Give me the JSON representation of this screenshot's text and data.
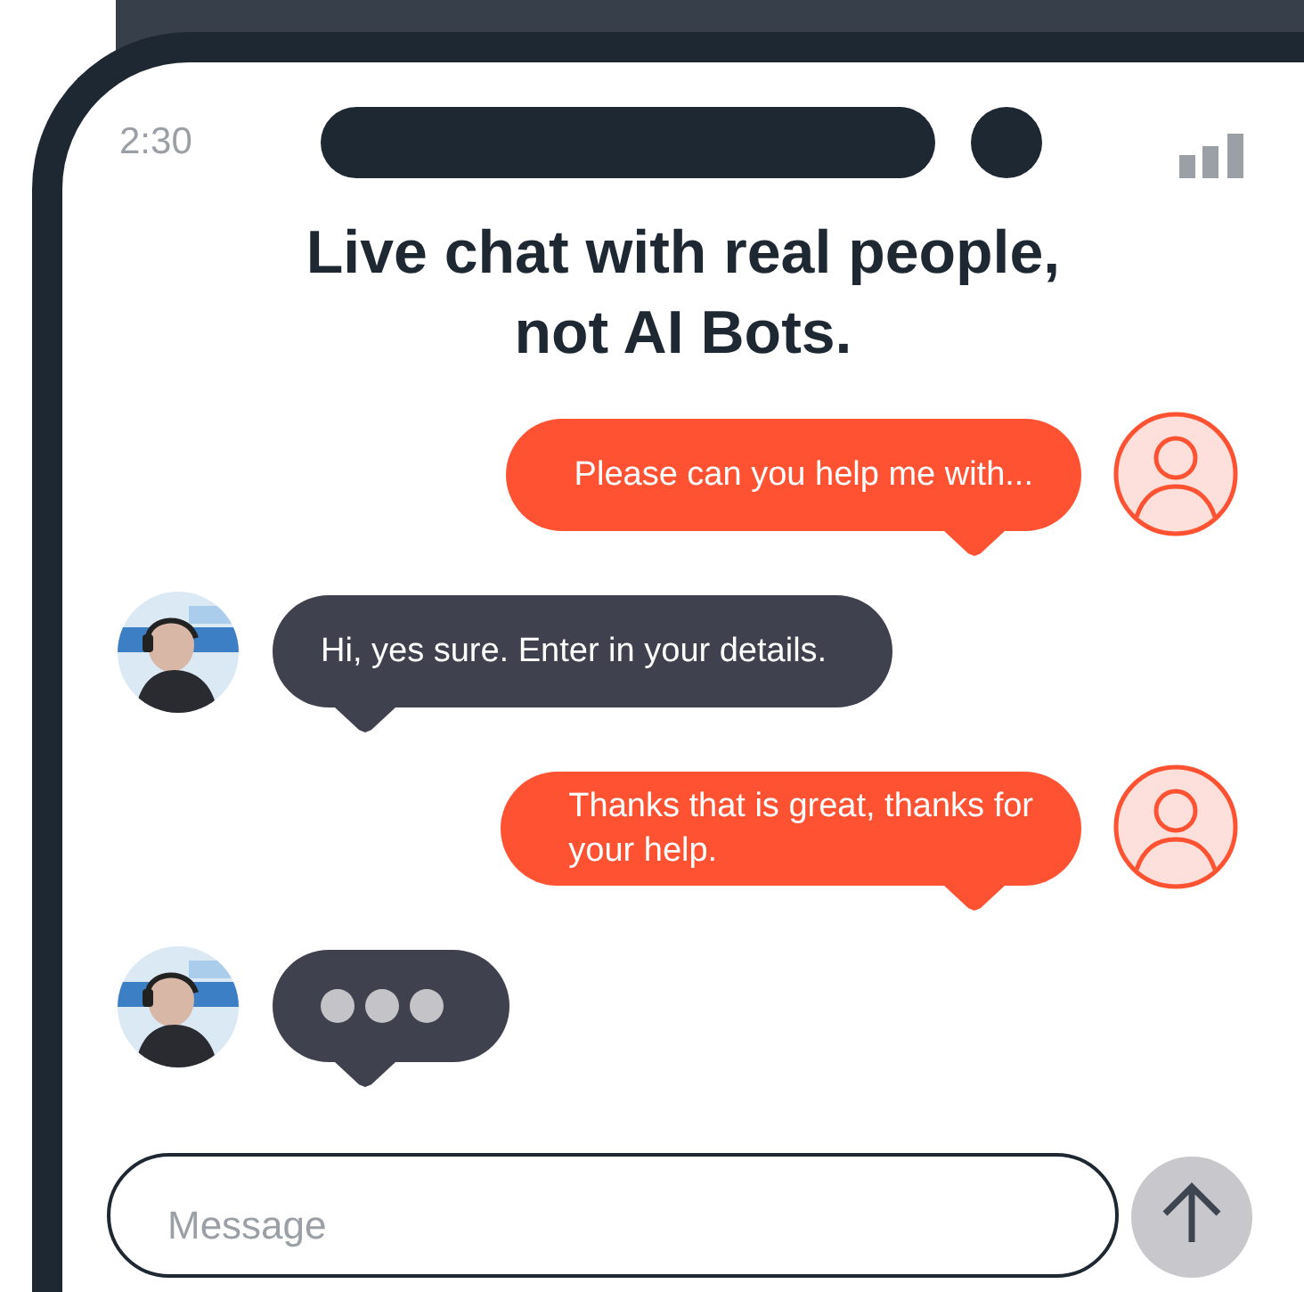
{
  "status_bar": {
    "time": "2:30"
  },
  "heading": "Live chat with real people,\nnot AI Bots.",
  "messages": [
    {
      "outgoing": true,
      "kind": "text",
      "text": "Please can you help me with..."
    },
    {
      "outgoing": false,
      "kind": "text",
      "text": "Hi, yes sure. Enter in your details."
    },
    {
      "outgoing": true,
      "kind": "text",
      "text": "Thanks that is great, thanks for\nyour help."
    },
    {
      "outgoing": false,
      "kind": "typing"
    }
  ],
  "composer": {
    "placeholder": "Message"
  }
}
